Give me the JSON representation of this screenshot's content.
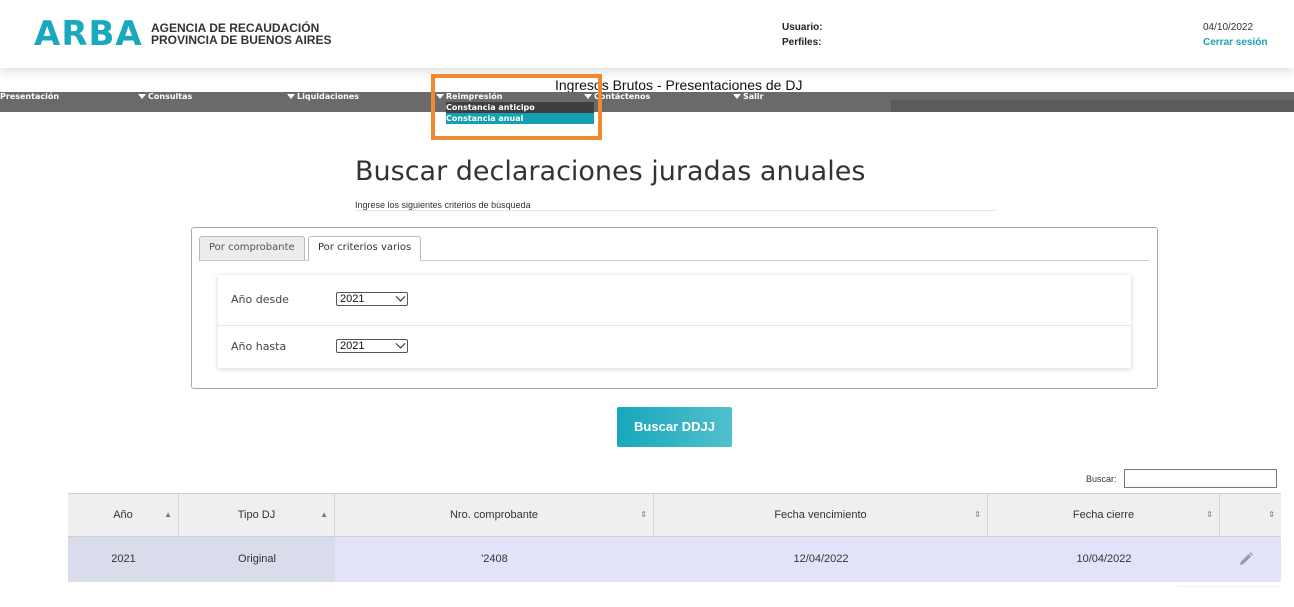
{
  "header": {
    "logo": "ARBA",
    "agency_line1": "AGENCIA DE RECAUDACIÓN",
    "agency_line2": "PROVINCIA DE BUENOS AIRES",
    "usuario_label": "Usuario:",
    "perfiles_label": "Perfiles:",
    "date": "04/10/2022",
    "logout": "Cerrar sesión"
  },
  "page_title": "Ingresos Brutos - Presentaciones de DJ",
  "menu": {
    "items": [
      {
        "label": "Presentación",
        "has_arrow": false
      },
      {
        "label": "Consultas",
        "has_arrow": true
      },
      {
        "label": "Liquidaciones",
        "has_arrow": true
      },
      {
        "label": "Reimpresión",
        "has_arrow": true
      },
      {
        "label": "Contáctenos",
        "has_arrow": true
      },
      {
        "label": "Salir",
        "has_arrow": true
      }
    ],
    "dropdown": [
      "Constancia anticipo",
      "Constancia anual"
    ]
  },
  "main": {
    "heading": "Buscar declaraciones juradas anuales",
    "subtext": "Ingrese los siguientes criterios de búsqueda",
    "tabs": [
      {
        "label": "Por comprobante",
        "active": false
      },
      {
        "label": "Por criterios varios",
        "active": true
      }
    ],
    "fields": [
      {
        "label": "Año desde",
        "value": "2021"
      },
      {
        "label": "Año hasta",
        "value": "2021"
      }
    ],
    "search_button": "Buscar DDJJ"
  },
  "table": {
    "search_label": "Buscar:",
    "search_value": "",
    "columns": [
      "Año",
      "Tipo DJ",
      "Nro. comprobante",
      "Fecha vencimiento",
      "Fecha cierre",
      ""
    ],
    "rows": [
      {
        "anio": "2021",
        "tipo": "Original",
        "nro": "'2408",
        "vencimiento": "12/04/2022",
        "cierre": "10/04/2022"
      }
    ]
  },
  "colors": {
    "accent": "#1aa8bf",
    "menu_bg": "#6a6a6a",
    "highlight": "#f08a30"
  }
}
